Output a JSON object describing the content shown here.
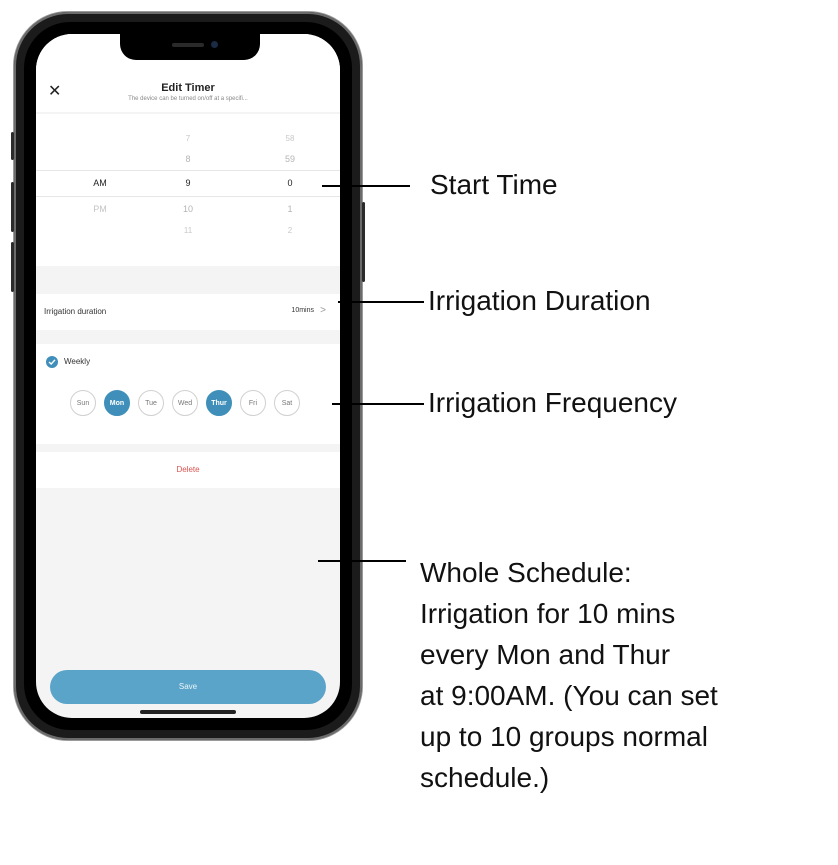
{
  "app": {
    "title": "Edit Timer",
    "subtitle": "The device can be turned on/off at a specifi...",
    "close_icon": "✕"
  },
  "picker": {
    "ampm": [
      "",
      "",
      "AM",
      "PM",
      ""
    ],
    "hours": [
      "",
      "7",
      "8",
      "9",
      "10",
      "11"
    ],
    "minutes": [
      "",
      "58",
      "59",
      "0",
      "1",
      "2"
    ]
  },
  "duration": {
    "label": "Irrigation duration",
    "value": "10mins",
    "chevron": ">"
  },
  "frequency": {
    "label": "Weekly",
    "days": [
      {
        "label": "Sun",
        "selected": false
      },
      {
        "label": "Mon",
        "selected": true
      },
      {
        "label": "Tue",
        "selected": false
      },
      {
        "label": "Wed",
        "selected": false
      },
      {
        "label": "Thur",
        "selected": true
      },
      {
        "label": "Fri",
        "selected": false
      },
      {
        "label": "Sat",
        "selected": false
      }
    ]
  },
  "delete_label": "Delete",
  "save_label": "Save",
  "annotations": {
    "start_time": "Start Time",
    "duration": "Irrigation Duration",
    "frequency": "Irrigation Frequency",
    "schedule_lines": [
      "Whole Schedule:",
      "Irrigation for 10 mins",
      "every Mon and Thur",
      "at 9:00AM. (You can set",
      "up to 10 groups normal",
      "schedule.)"
    ]
  },
  "colors": {
    "accent": "#3f8fba",
    "save": "#5ba4c9",
    "delete": "#d9534f"
  }
}
